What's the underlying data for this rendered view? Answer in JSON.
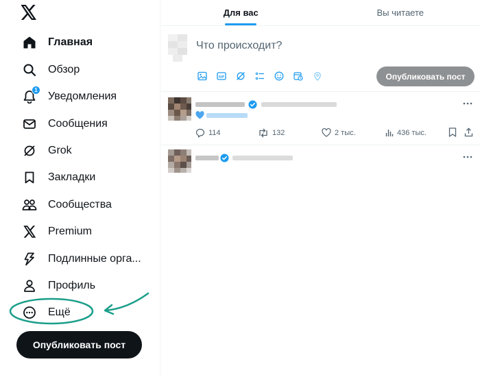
{
  "sidebar": {
    "items": [
      {
        "label": "Главная",
        "icon": "home-icon"
      },
      {
        "label": "Обзор",
        "icon": "search-icon"
      },
      {
        "label": "Уведомления",
        "icon": "bell-icon",
        "badge": "1"
      },
      {
        "label": "Сообщения",
        "icon": "mail-icon"
      },
      {
        "label": "Grok",
        "icon": "grok-icon"
      },
      {
        "label": "Закладки",
        "icon": "bookmark-icon"
      },
      {
        "label": "Сообщества",
        "icon": "communities-icon"
      },
      {
        "label": "Premium",
        "icon": "x-logo-icon"
      },
      {
        "label": "Подлинные орга...",
        "icon": "lightning-icon"
      },
      {
        "label": "Профиль",
        "icon": "person-icon"
      },
      {
        "label": "Ещё",
        "icon": "more-circle-icon"
      }
    ],
    "post_button": "Опубликовать пост",
    "annotation_color": "#1a9e8a"
  },
  "main": {
    "tabs": [
      {
        "label": "Для вас",
        "active": true
      },
      {
        "label": "Вы читаете",
        "active": false
      }
    ],
    "composer": {
      "placeholder": "Что происходит?",
      "post_button": "Опубликовать пост",
      "tools": [
        "image-icon",
        "gif-icon",
        "grok-icon",
        "poll-icon",
        "emoji-icon",
        "schedule-icon",
        "location-icon"
      ]
    },
    "tweets": [
      {
        "stats": {
          "replies": "114",
          "reposts": "132",
          "likes": "2 тыс.",
          "views": "436 тыс."
        }
      },
      {}
    ]
  },
  "colors": {
    "accent": "#1d9bf0",
    "text": "#0f1419",
    "muted": "#536471"
  }
}
